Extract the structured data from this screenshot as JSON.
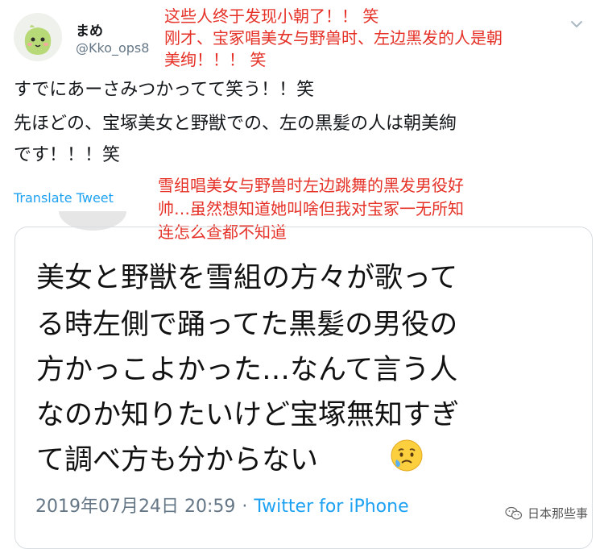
{
  "author": {
    "display_name": "まめ",
    "handle": "@Kko_ops8"
  },
  "annotations": {
    "note1": [
      "这些人终于发现小朝了！！ 笑",
      "刚才、宝冢唱美女与野兽时、左边黑发的人是朝",
      "美绚！！！ 笑"
    ],
    "note2": [
      "雪组唱美女与野兽时左边跳舞的黑发男役好",
      "帅…虽然想知道她叫啥但我对宝冢一无所知",
      "连怎么查都不知道"
    ]
  },
  "tweet": {
    "lines": [
      "すでにあーさみつかってて笑う！！笑",
      "先ほどの、宝塚美女と野獣での、左の黒髪の人は朝美絢",
      "です！！！笑"
    ],
    "translate_label": "Translate Tweet"
  },
  "quoted": {
    "lines": [
      "美女と野獣を雪組の方々が歌って",
      "る時左側で踊ってた黒髪の男役の",
      "方かっこよかった…なんて言う人",
      "なのか知りたいけど宝塚無知すぎ",
      "て調べ方も分からない"
    ],
    "emoji": "crying-face-icon",
    "timestamp": "2019年07月24日 20:59",
    "separator": "·",
    "source": "Twitter for iPhone"
  },
  "watermark": {
    "text": "日本那些事"
  },
  "colors": {
    "annotation_red": "#e53127",
    "link_blue": "#1da1f2",
    "muted_gray": "#657786"
  }
}
